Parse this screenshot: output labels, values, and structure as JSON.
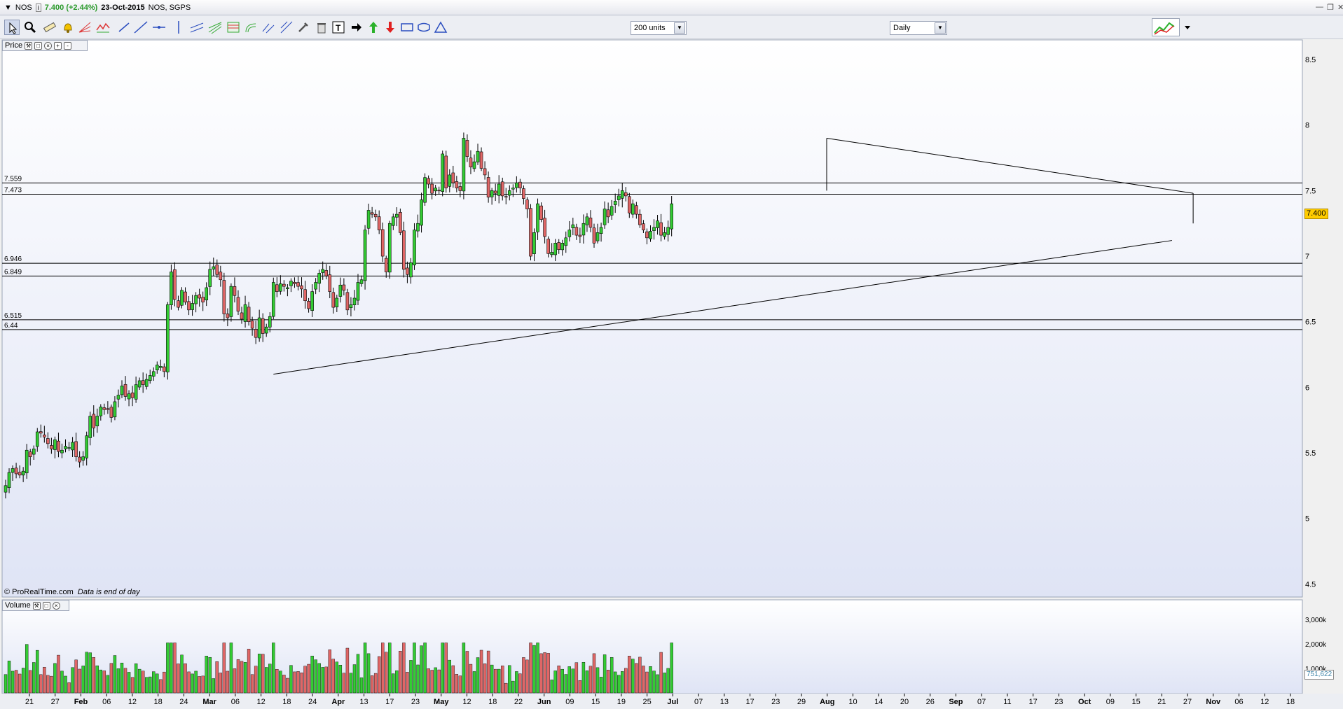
{
  "window": {
    "symbol": "NOS",
    "price_change": "7.400 (+2.44%)",
    "date": "23-Oct-2015",
    "name": "NOS, SGPS"
  },
  "toolbar": {
    "units_select": "200 units",
    "period_select": "Daily"
  },
  "price_panel": {
    "label": "Price",
    "current_price_tag": "7.400"
  },
  "volume_panel": {
    "label": "Volume",
    "current_volume_tag": "751,622"
  },
  "copyright": {
    "source": "© ProRealTime.com",
    "note": "Data is end of day"
  },
  "colors": {
    "up": "#33cc33",
    "down": "#e06666",
    "line": "#000000"
  },
  "chart_data": [
    {
      "type": "candlestick",
      "y_ticks": [
        "4.5",
        "5",
        "5.5",
        "6",
        "6.5",
        "7",
        "7.5",
        "8",
        "8.5"
      ],
      "ylim": [
        4.4,
        8.65
      ],
      "x_ticks": [
        "21",
        "27",
        "Feb",
        "06",
        "12",
        "18",
        "24",
        "Mar",
        "06",
        "12",
        "18",
        "24",
        "Apr",
        "13",
        "17",
        "23",
        "May",
        "12",
        "18",
        "22",
        "Jun",
        "09",
        "15",
        "19",
        "25",
        "Jul",
        "07",
        "13",
        "17",
        "23",
        "29",
        "Aug",
        "10",
        "14",
        "20",
        "26",
        "Sep",
        "07",
        "11",
        "17",
        "23",
        "Oct",
        "09",
        "15",
        "21",
        "27",
        "Nov",
        "06",
        "12",
        "18"
      ],
      "horizontal_levels": [
        {
          "label": "7.559",
          "value": 7.559
        },
        {
          "label": "7.473",
          "value": 7.473
        },
        {
          "label": "6.946",
          "value": 6.946
        },
        {
          "label": "6.849",
          "value": 6.849
        },
        {
          "label": "6.515",
          "value": 6.515
        },
        {
          "label": "6.44",
          "value": 6.44
        }
      ],
      "trendlines": [
        {
          "from_index": 76,
          "from_value": 6.1,
          "to_index": 331,
          "to_value": 7.12
        },
        {
          "from_index": 233,
          "from_value": 7.9,
          "to_index": 337,
          "to_value": 7.48
        },
        {
          "from_index": 233,
          "from_value": 7.9,
          "to_index": 233,
          "to_value": 7.5
        },
        {
          "from_index": 337,
          "from_value": 7.48,
          "to_index": 337,
          "to_value": 7.25
        }
      ],
      "closes": [
        5.25,
        5.35,
        5.38,
        5.34,
        5.33,
        5.36,
        5.52,
        5.47,
        5.53,
        5.66,
        5.65,
        5.62,
        5.57,
        5.53,
        5.6,
        5.51,
        5.52,
        5.55,
        5.54,
        5.58,
        5.47,
        5.43,
        5.47,
        5.63,
        5.78,
        5.69,
        5.78,
        5.85,
        5.83,
        5.83,
        5.77,
        5.89,
        5.94,
        6.01,
        5.93,
        5.95,
        5.92,
        6.02,
        6.05,
        6.02,
        6.06,
        6.09,
        6.12,
        6.17,
        6.16,
        6.12,
        6.63,
        6.88,
        6.67,
        6.61,
        6.74,
        6.65,
        6.59,
        6.64,
        6.7,
        6.68,
        6.65,
        6.76,
        6.9,
        6.92,
        6.86,
        6.82,
        6.56,
        6.53,
        6.77,
        6.7,
        6.58,
        6.52,
        6.63,
        6.5,
        6.45,
        6.38,
        6.53,
        6.41,
        6.46,
        6.54,
        6.8,
        6.73,
        6.79,
        6.77,
        6.76,
        6.81,
        6.79,
        6.77,
        6.75,
        6.66,
        6.6,
        6.73,
        6.8,
        6.87,
        6.9,
        6.85,
        6.73,
        6.61,
        6.68,
        6.78,
        6.74,
        6.59,
        6.63,
        6.68,
        6.8,
        6.82,
        7.2,
        7.35,
        7.32,
        7.3,
        7.2,
        7.0,
        6.88,
        7.25,
        7.3,
        7.32,
        7.18,
        6.9,
        6.86,
        6.95,
        7.2,
        7.25,
        7.43,
        7.6,
        7.55,
        7.48,
        7.52,
        7.5,
        7.78,
        7.52,
        7.62,
        7.56,
        7.52,
        7.5,
        7.9,
        7.76,
        7.68,
        7.72,
        7.8,
        7.67,
        7.62,
        7.45,
        7.5,
        7.48,
        7.55,
        7.46,
        7.45,
        7.5,
        7.52,
        7.56,
        7.52,
        7.44,
        7.36,
        7.0,
        7.18,
        7.4,
        7.28,
        7.15,
        7.02,
        7.03,
        7.1,
        7.05,
        7.1,
        7.14,
        7.2,
        7.24,
        7.16,
        7.15,
        7.25,
        7.3,
        7.22,
        7.1,
        7.18,
        7.22,
        7.36,
        7.3,
        7.38,
        7.42,
        7.46,
        7.5,
        7.46,
        7.33,
        7.4,
        7.32,
        7.24,
        7.2,
        7.14,
        7.19,
        7.22,
        7.27,
        7.16,
        7.18,
        7.22,
        7.4
      ]
    },
    {
      "type": "bar",
      "series_name": "Volume",
      "y_ticks": [
        "1,000k",
        "2,000k",
        "3,000k"
      ],
      "ylim": [
        0,
        3500
      ]
    }
  ]
}
